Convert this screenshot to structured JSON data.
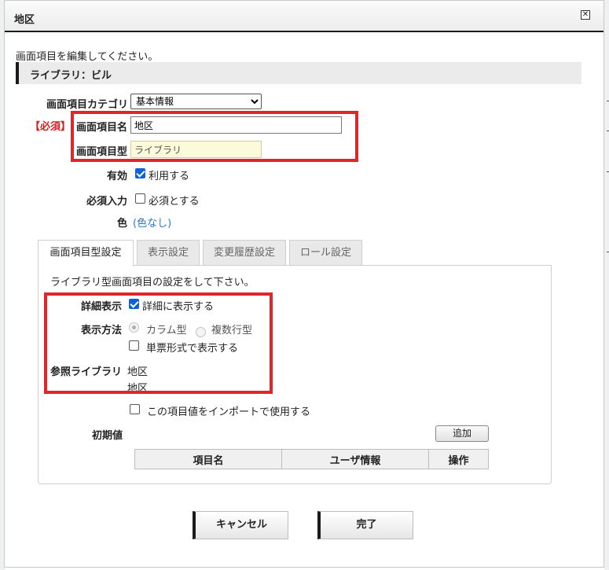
{
  "dialog": {
    "title": "地区",
    "close_icon": "close-icon"
  },
  "intro": "画面項目を編集してください。",
  "section_header": "ライブラリ：ビル",
  "form": {
    "category_label": "画面項目カテゴリ",
    "category_value": "基本情報",
    "required_badge": "【必須】",
    "name_label": "画面項目名",
    "name_value": "地区",
    "type_label": "画面項目型",
    "type_value": "ライブラリ",
    "enabled_label": "有効",
    "enabled_checked": true,
    "enabled_text": "利用する",
    "mandatory_label": "必須入力",
    "mandatory_checked": false,
    "mandatory_text": "必須とする",
    "color_label": "色",
    "color_value": "(色なし)"
  },
  "tabs": [
    {
      "label": "画面項目型設定",
      "active": true
    },
    {
      "label": "表示設定",
      "active": false
    },
    {
      "label": "変更履歴設定",
      "active": false
    },
    {
      "label": "ロール設定",
      "active": false
    }
  ],
  "panel": {
    "description": "ライブラリ型画面項目の設定をして下さい。",
    "detail_label": "詳細表示",
    "detail_checked": true,
    "detail_text": "詳細に表示する",
    "display_label": "表示方法",
    "display_options": [
      "カラム型",
      "複数行型"
    ],
    "display_selected": "カラム型",
    "single_form_checked": false,
    "single_form_text": "単票形式で表示する",
    "ref_library_label": "参照ライブラリ",
    "ref_library_line1": "地区",
    "ref_library_line2": "地区",
    "import_checked": false,
    "import_text": "この項目値をインポートで使用する",
    "initial_label": "初期値",
    "add_button": "追加",
    "table_headers": [
      "項目名",
      "ユーザ情報",
      "操作"
    ]
  },
  "footer": {
    "cancel_button": "キャンセル",
    "done_button": "完了"
  },
  "colors": {
    "highlight": "#e0252b",
    "link": "#2a78c8",
    "check": "#0a63d8",
    "required": "#d02020"
  }
}
